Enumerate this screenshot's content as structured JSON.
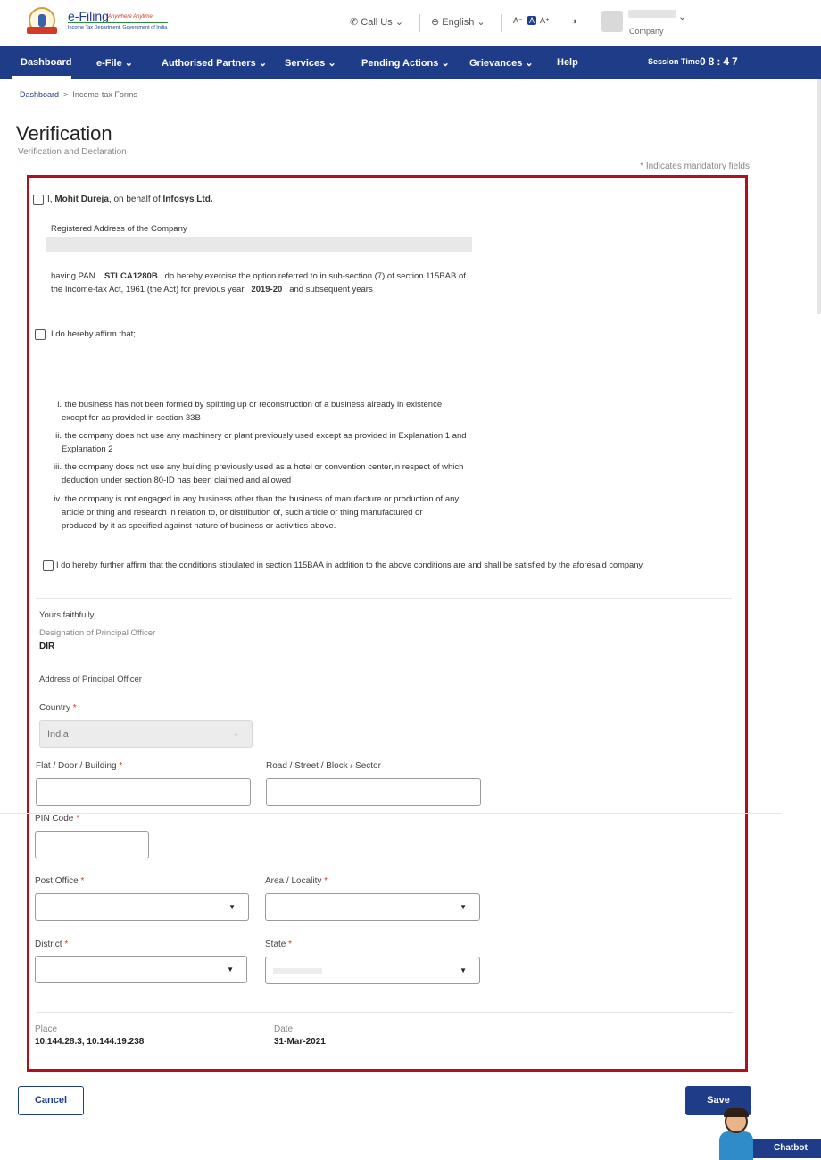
{
  "header": {
    "logo_title": "e-Filing",
    "logo_tagline": "Anywhere Anytime",
    "logo_subtitle": "Income Tax Department, Government of India",
    "call_us": "Call Us",
    "language": "English",
    "font_decrease": "A⁻",
    "font_normal": "A",
    "font_increase": "A⁺",
    "user_role": "Company"
  },
  "nav": {
    "items": [
      "Dashboard",
      "e-File",
      "Authorised Partners",
      "Services",
      "Pending Actions",
      "Grievances",
      "Help"
    ],
    "session_label": "Session Time",
    "session_value": "08:47"
  },
  "breadcrumb": {
    "home": "Dashboard",
    "separator": ">",
    "current": "Income-tax Forms"
  },
  "page": {
    "title": "Verification",
    "subtitle": "Verification and Declaration",
    "mandatory_note": "* Indicates mandatory fields"
  },
  "declaration": {
    "prefix": "I,",
    "person_name": "Mohit Dureja",
    "on_behalf": ", on behalf of",
    "company_name": "Infosys Ltd.",
    "registered_address_label": "Registered Address of the Company",
    "having_pan": "having PAN",
    "pan": "STLCA1280B",
    "option_text": "do hereby exercise the option referred to in sub-section (7) of section 115BAB of",
    "act_text": "the Income-tax Act, 1961 (the Act) for previous year",
    "year": "2019-20",
    "subsequent": "and subsequent years"
  },
  "affirm": {
    "label": "I do hereby affirm that;",
    "items": [
      {
        "num": "i.",
        "line1": "the business has not been formed by splitting up or reconstruction of a business already in existence",
        "line2": "except for as provided in section 33B",
        "line3": ""
      },
      {
        "num": "ii.",
        "line1": "the company does not use any machinery or plant previously used except as provided in Explanation 1 and",
        "line2": "Explanation 2",
        "line3": ""
      },
      {
        "num": "iii.",
        "line1": "the company does not use any building previously used as a hotel or convention center,in respect of which",
        "line2": "deduction under section 80-ID has been claimed and allowed",
        "line3": ""
      },
      {
        "num": "iv.",
        "line1": "the company is not engaged in any business other than the business of manufacture or production of any",
        "line2": "article or thing and research in relation to, or distribution of, such article or thing manufactured or",
        "line3": "produced by it as specified against nature of business or activities above."
      }
    ],
    "further": "I do hereby further affirm that the conditions stipulated in section 115BAA in addition to the above conditions are and shall be satisfied by the aforesaid company."
  },
  "signature": {
    "yours_faithfully": "Yours faithfully,",
    "designation_label": "Designation of Principal Officer",
    "designation_value": "DIR",
    "address_label": "Address of Principal Officer"
  },
  "form": {
    "country_label": "Country",
    "country_value": "India",
    "flat_label": "Flat / Door / Building",
    "road_label": "Road / Street / Block / Sector",
    "pin_label": "PIN Code",
    "post_office_label": "Post Office",
    "area_label": "Area / Locality",
    "district_label": "District",
    "state_label": "State",
    "required_mark": "*",
    "dropdown_caret": "▼"
  },
  "footer": {
    "place_label": "Place",
    "place_value": "10.144.28.3, 10.144.19.238",
    "date_label": "Date",
    "date_value": "31-Mar-2021"
  },
  "actions": {
    "cancel": "Cancel",
    "save": "Save",
    "chatbot": "Chatbot"
  }
}
